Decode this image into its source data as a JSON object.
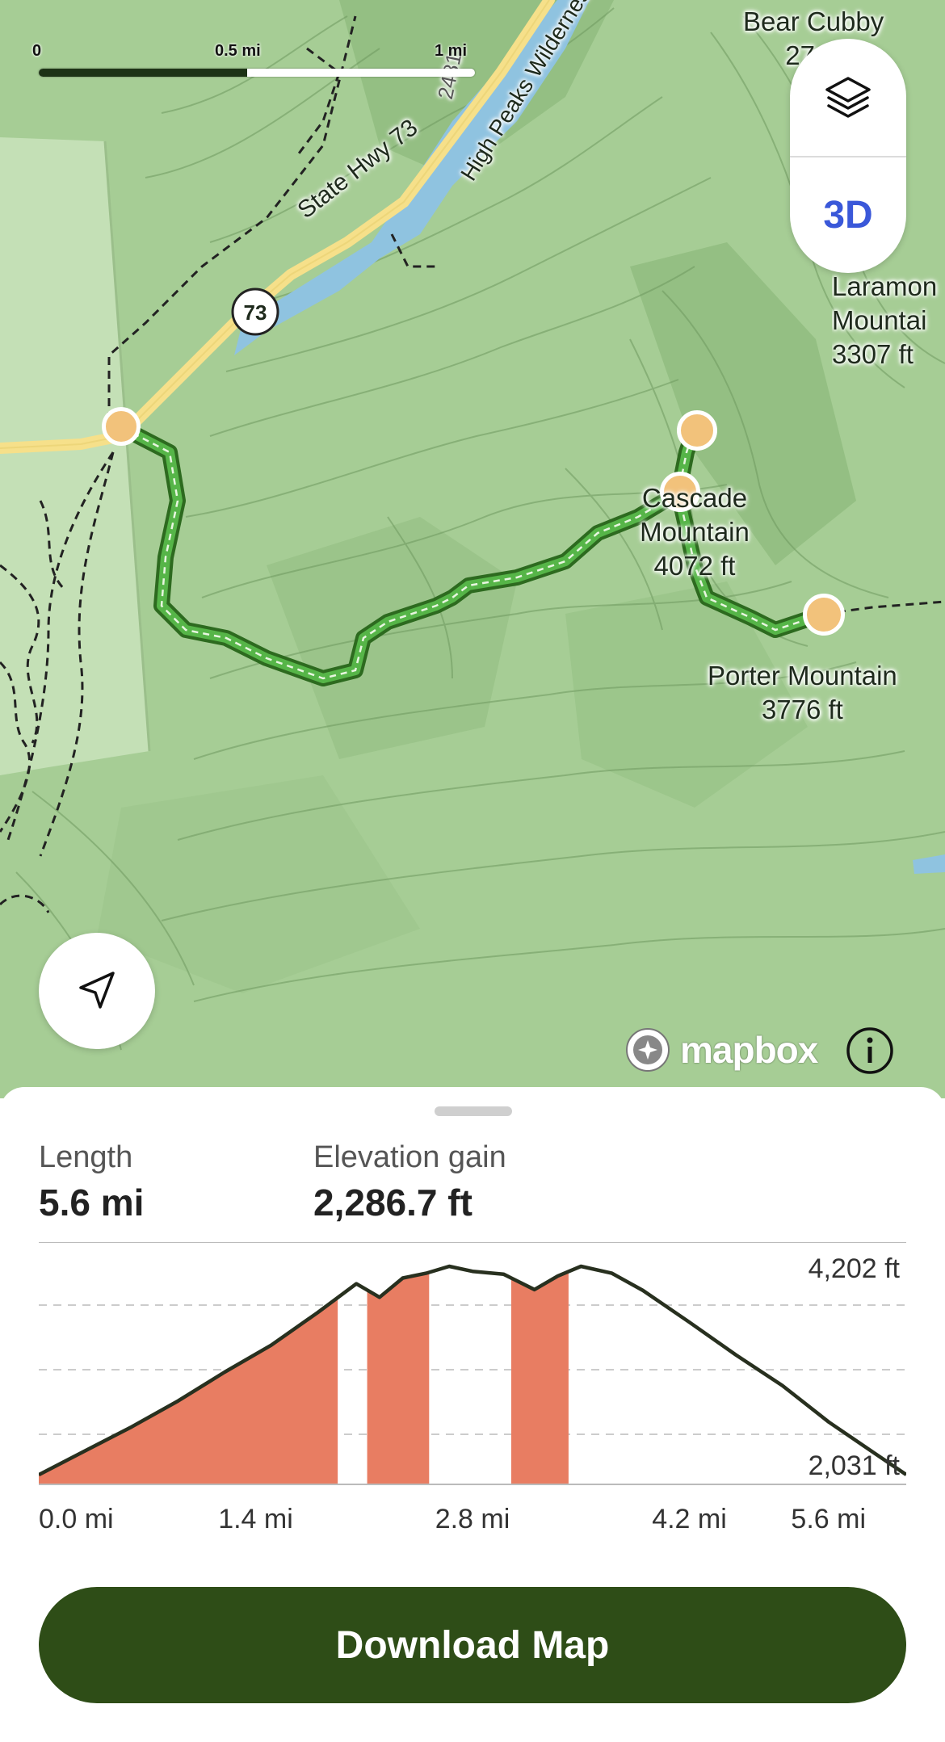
{
  "map": {
    "scale": {
      "labels": [
        "0",
        "0.5 mi",
        "1 mi"
      ]
    },
    "roads": [
      {
        "name": "State Hwy 73",
        "shield": "73"
      },
      {
        "name": "High Peaks Wilderness"
      },
      {
        "number": "2481"
      }
    ],
    "peaks": [
      {
        "name": "Bear Cubby",
        "elevation": "27…"
      },
      {
        "name": "Laramon Mountai",
        "elevation": "3307 ft"
      },
      {
        "name": "Cascade Mountain",
        "elevation": "4072 ft"
      },
      {
        "name": "Porter Mountain",
        "elevation": "3776 ft"
      }
    ],
    "controls": {
      "layers_icon": "layers-icon",
      "view_3d_label": "3D",
      "locate_icon": "navigation-arrow-icon"
    },
    "attribution": {
      "brand": "mapbox",
      "info_icon": "info-icon"
    },
    "colors": {
      "route": "#3f9c35",
      "waypoint": "#f2c27b",
      "water": "#8fc3e0",
      "highway": "#f6e08a"
    }
  },
  "stats": {
    "length_label": "Length",
    "length_value": "5.6 mi",
    "elevation_label": "Elevation gain",
    "elevation_value": "2,286.7 ft"
  },
  "chart_data": {
    "type": "area",
    "x": [
      0,
      0.3,
      0.6,
      0.9,
      1.2,
      1.5,
      1.8,
      2.05,
      2.2,
      2.35,
      2.5,
      2.65,
      2.8,
      3.0,
      3.2,
      3.35,
      3.5,
      3.7,
      3.9,
      4.2,
      4.5,
      4.8,
      5.1,
      5.4,
      5.6
    ],
    "y": [
      2030,
      2280,
      2530,
      2800,
      3100,
      3380,
      3720,
      4020,
      3880,
      4080,
      4130,
      4202,
      4150,
      4120,
      3960,
      4100,
      4202,
      4130,
      3950,
      3620,
      3280,
      2960,
      2580,
      2250,
      2031
    ],
    "highlight_ranges_mi": [
      [
        0,
        1.93
      ],
      [
        2.12,
        2.52
      ],
      [
        3.05,
        3.42
      ]
    ],
    "ymin_label": "2,031 ft",
    "ymax_label": "4,202 ft",
    "ylim": [
      2031,
      4202
    ],
    "xlim": [
      0,
      5.6
    ],
    "x_tick_labels": [
      "0.0 mi",
      "1.4 mi",
      "2.8 mi",
      "4.2 mi",
      "5.6 mi"
    ],
    "x_ticks": [
      0,
      1.4,
      2.8,
      4.2,
      5.6
    ],
    "colors": {
      "line": "#28301f",
      "fill": "#e87d62",
      "grid": "#cccccc"
    },
    "grid": true
  },
  "download_button": {
    "label": "Download Map"
  }
}
